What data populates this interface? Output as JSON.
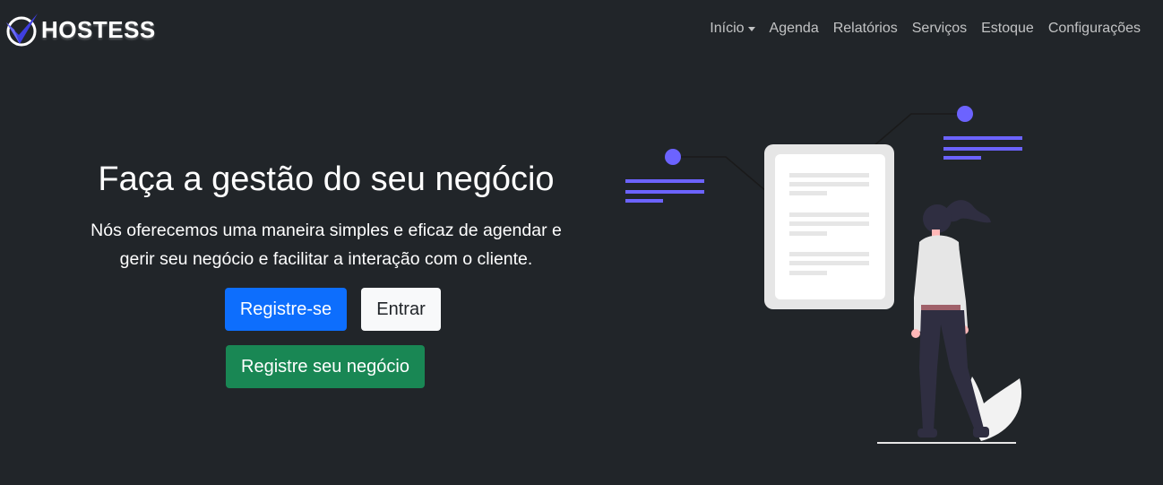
{
  "navbar": {
    "brand": "HOSTESS",
    "links": [
      {
        "label": "Início",
        "dropdown": true
      },
      {
        "label": "Agenda"
      },
      {
        "label": "Relatórios"
      },
      {
        "label": "Serviços"
      },
      {
        "label": "Estoque"
      },
      {
        "label": "Configurações"
      }
    ]
  },
  "hero": {
    "title": "Faça a gestão do seu negócio",
    "description_line1": "Nós oferecemos uma maneira simples e eficaz de agendar e",
    "description_line2": "gerir seu negócio e facilitar a interação com o cliente.",
    "register_label": "Registre-se",
    "login_label": "Entrar",
    "register_business_label": "Registre seu negócio"
  },
  "colors": {
    "background": "#212529",
    "primary": "#0d6efd",
    "success": "#198754",
    "light": "#f8f9fa",
    "accent": "#6c63ff"
  },
  "icons": {
    "brand_logo": "check-shield-logo-icon",
    "dropdown": "caret-down-icon"
  }
}
